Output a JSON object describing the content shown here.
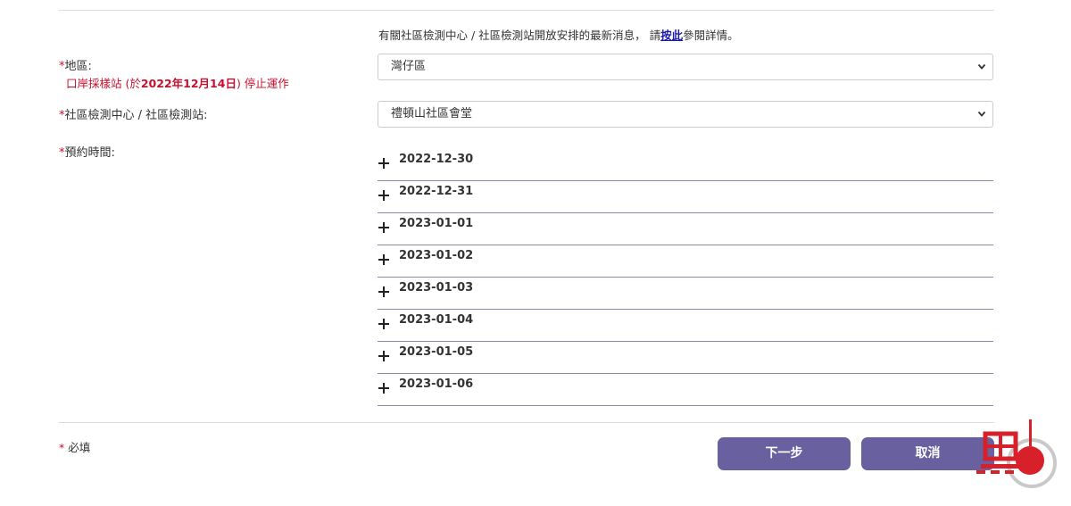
{
  "notice": {
    "prefix": "有關社區檢測中心 / 社區檢測站開放安排的最新消息， 請",
    "link": "按此",
    "suffix": "參閱詳情。"
  },
  "district": {
    "required_mark": "*",
    "label": "地區:",
    "note_prefix": "口岸採樣站 (於",
    "note_date": "2022年12月14日",
    "note_suffix": ") 停止運作",
    "value": "灣仔區"
  },
  "centre": {
    "required_mark": "*",
    "label": "社區檢測中心 / 社區檢測站:",
    "value": "禮頓山社區會堂"
  },
  "time": {
    "required_mark": "*",
    "label": "預約時間:"
  },
  "dates": [
    "2022-12-30",
    "2022-12-31",
    "2023-01-01",
    "2023-01-02",
    "2023-01-03",
    "2023-01-04",
    "2023-01-05",
    "2023-01-06"
  ],
  "footer": {
    "required_mark": "*",
    "required_text": "必填",
    "next_label": "下一步",
    "cancel_label": "取消"
  },
  "colors": {
    "button": "#68609f",
    "required": "#c8102e",
    "divider": "#8c86a8",
    "logo_red": "#d8202a"
  },
  "icons": {
    "expand": "plus-icon",
    "dropdown": "chevron-down-icon"
  }
}
